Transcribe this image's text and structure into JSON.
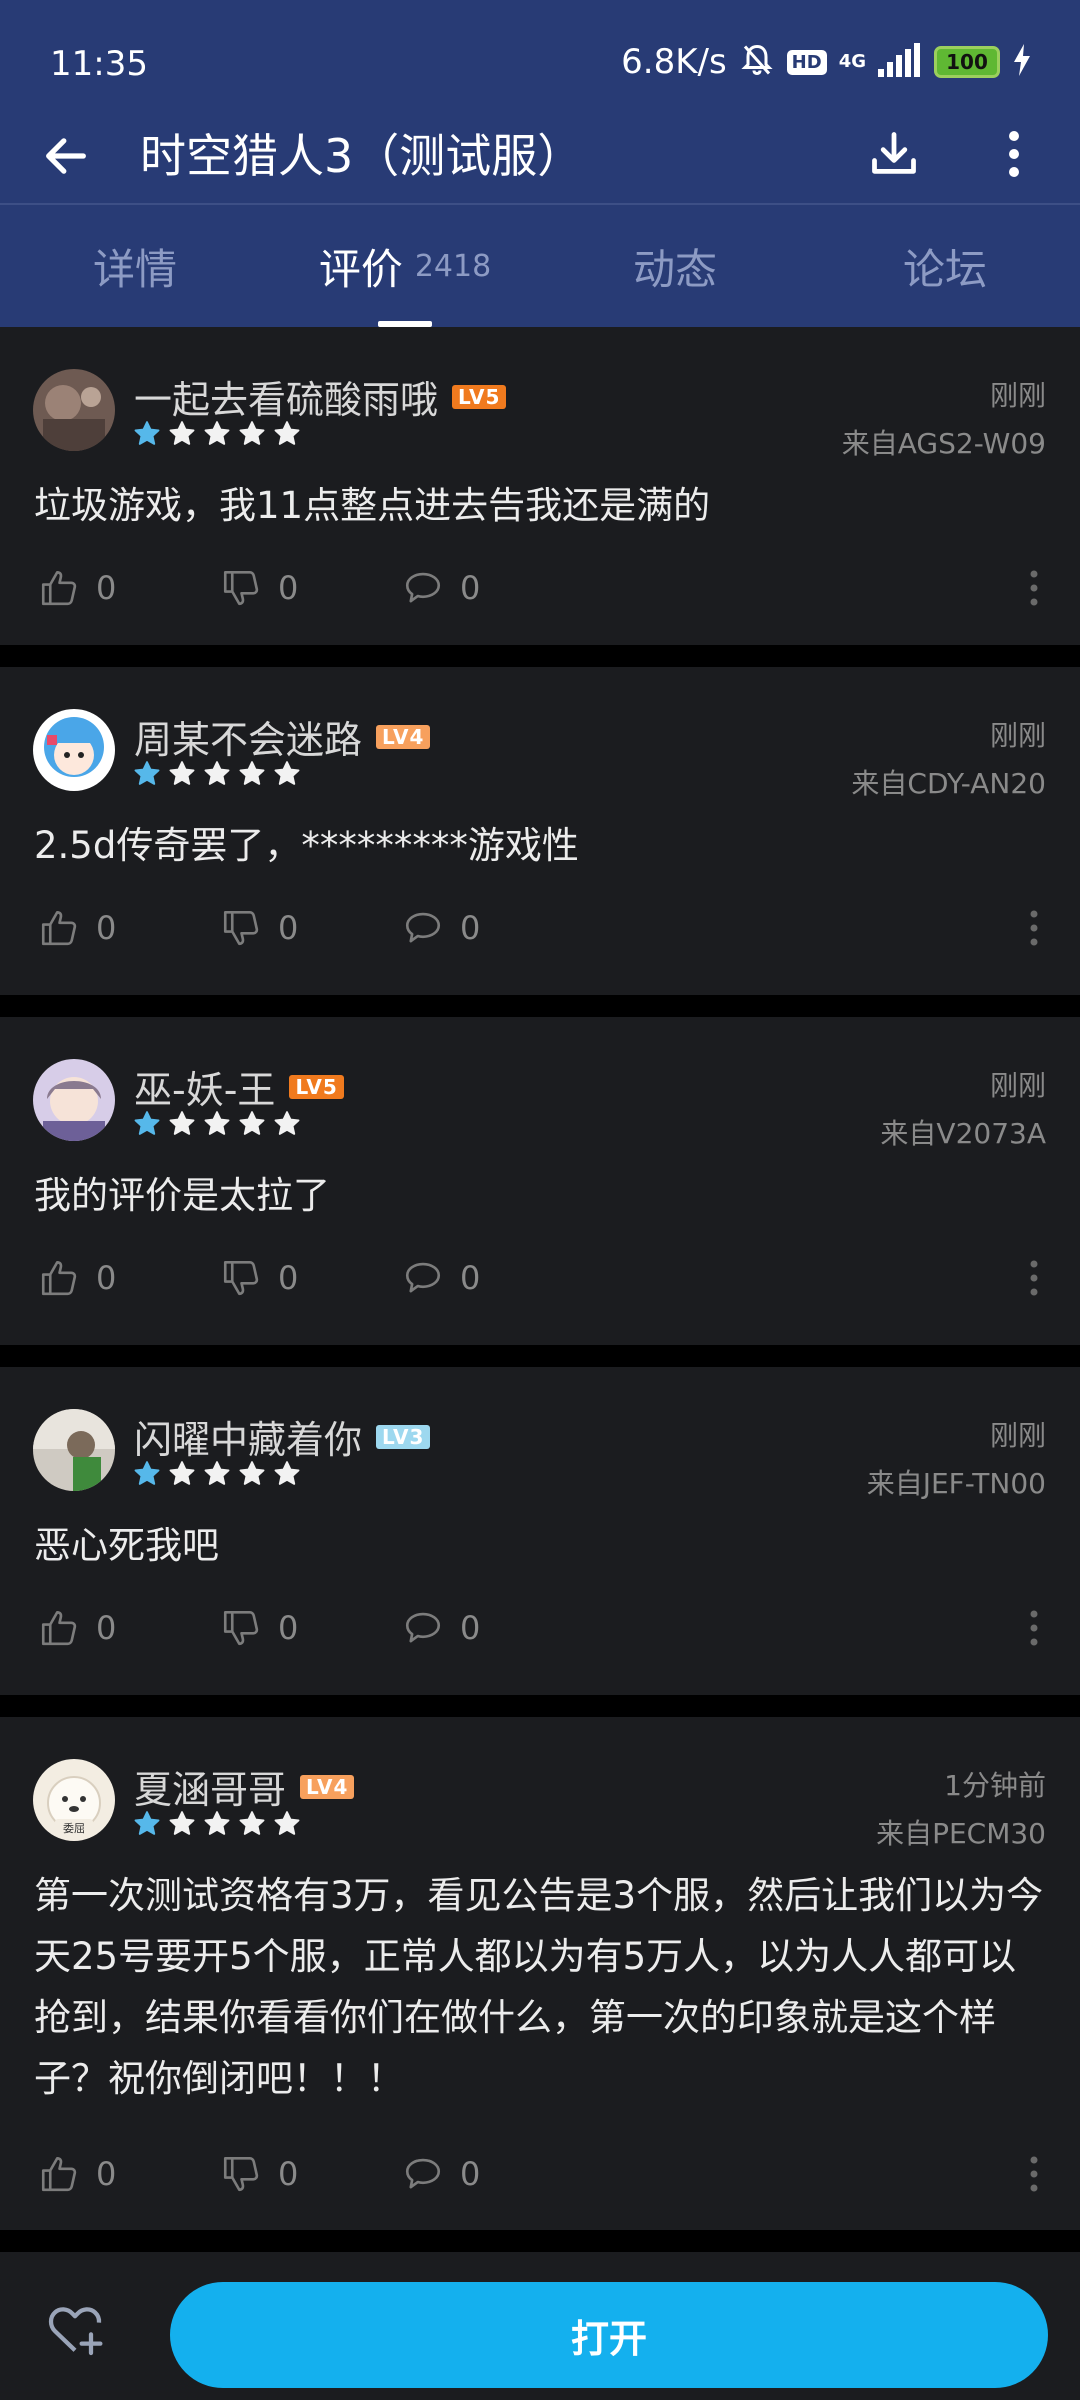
{
  "status_bar": {
    "time": "11:35",
    "net_speed": "6.8K/s",
    "hd_label": "HD",
    "network": "4G",
    "battery": "100"
  },
  "title_bar": {
    "title": "时空猎人3（测试服）"
  },
  "tabs": [
    {
      "label": "详情",
      "count": ""
    },
    {
      "label": "评价",
      "count": "2418"
    },
    {
      "label": "动态",
      "count": ""
    },
    {
      "label": "论坛",
      "count": ""
    }
  ],
  "active_tab": 1,
  "colors": {
    "header_bg": "#283b75",
    "card_bg": "#1b1c1f",
    "star_filled": "#56b8ea",
    "star_empty": "#f2f2f2",
    "open_button": "#14b0ee"
  },
  "reviews": [
    {
      "username": "一起去看硫酸雨哦",
      "level": "LV5",
      "rating": 1,
      "time": "刚刚",
      "device": "来自AGS2-W09",
      "content": "垃圾游戏，我11点整点进去告我还是满的",
      "likes": "0",
      "dislikes": "0",
      "comments": "0"
    },
    {
      "username": "周某不会迷路",
      "level": "LV4",
      "rating": 1,
      "time": "刚刚",
      "device": "来自CDY-AN20",
      "content": "2.5d传奇罢了，*********游戏性",
      "likes": "0",
      "dislikes": "0",
      "comments": "0"
    },
    {
      "username": "巫-妖-王",
      "level": "LV5",
      "rating": 1,
      "time": "刚刚",
      "device": "来自V2073A",
      "content": "我的评价是太拉了",
      "likes": "0",
      "dislikes": "0",
      "comments": "0"
    },
    {
      "username": "闪曜中藏着你",
      "level": "LV3",
      "rating": 1,
      "time": "刚刚",
      "device": "来自JEF-TN00",
      "content": "恶心死我吧",
      "likes": "0",
      "dislikes": "0",
      "comments": "0"
    },
    {
      "username": "夏涵哥哥",
      "level": "LV4",
      "rating": 1,
      "time": "1分钟前",
      "device": "来自PECM30",
      "content": "第一次测试资格有3万，看见公告是3个服，然后让我们以为今天25号要开5个服，正常人都以为有5万人，以为人人都可以抢到，结果你看看你们在做什么，第一次的印象就是这个样子？祝你倒闭吧！！！",
      "likes": "0",
      "dislikes": "0",
      "comments": "0"
    }
  ],
  "bottom_bar": {
    "open_label": "打开"
  }
}
